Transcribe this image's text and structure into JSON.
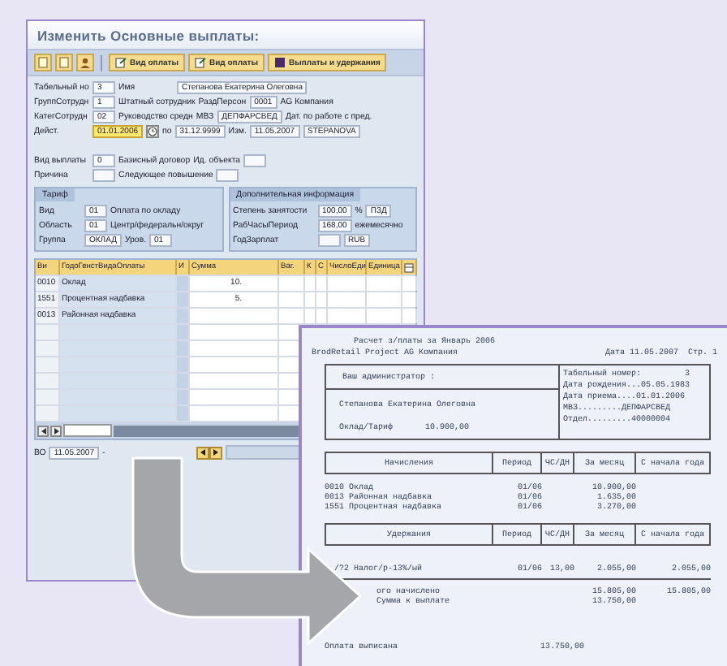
{
  "sap_window": {
    "title": "Изменить Основные выплаты:",
    "toolbar": [
      {
        "label": "Вид оплаты"
      },
      {
        "label": "Вид оплаты"
      },
      {
        "label": "Выплаты и удержания"
      }
    ],
    "header_rows": [
      [
        {
          "kind": "label",
          "text": "Табельный но"
        },
        {
          "kind": "field",
          "value": "3",
          "focused": false
        },
        {
          "kind": "label",
          "text": "Имя"
        },
        {
          "kind": "field",
          "value": "Степанова Екатерина Олеговна",
          "focused": false
        }
      ],
      [
        {
          "kind": "label",
          "text": "ГруппСотрудн"
        },
        {
          "kind": "field",
          "value": "1",
          "focused": false
        },
        {
          "kind": "text",
          "text": "Штатный сотрудник"
        },
        {
          "kind": "text",
          "text": "РаздПерсон"
        },
        {
          "kind": "field",
          "value": "0001",
          "focused": false
        },
        {
          "kind": "text",
          "text": "AG Компания"
        }
      ],
      [
        {
          "kind": "label",
          "text": "КатегСотрудн"
        },
        {
          "kind": "field",
          "value": "02",
          "focused": false
        },
        {
          "kind": "text",
          "text": "Руководство средн"
        },
        {
          "kind": "text",
          "text": "МВЗ"
        },
        {
          "kind": "field",
          "value": "ДЕПФАРСВЕД",
          "focused": false
        },
        {
          "kind": "text",
          "text": "Дат. по работе с пред."
        }
      ],
      [
        {
          "kind": "label",
          "text": "Дейст."
        },
        {
          "kind": "field",
          "value": "01.01.2006",
          "focused": true
        },
        {
          "kind": "calendar"
        },
        {
          "kind": "text",
          "text": "по"
        },
        {
          "kind": "field",
          "value": "31.12.9999",
          "focused": false
        },
        {
          "kind": "text",
          "text": "Изм."
        },
        {
          "kind": "field",
          "value": "11.05.2007",
          "focused": false
        },
        {
          "kind": "field",
          "value": "STEPANOVA",
          "focused": false
        }
      ]
    ],
    "reason_rows": [
      [
        {
          "kind": "label",
          "text": "Вид выплаты"
        },
        {
          "kind": "field",
          "value": "0",
          "focused": false
        },
        {
          "kind": "text",
          "text": "Базисный договор"
        },
        {
          "kind": "text",
          "text": "Ид. объекта"
        },
        {
          "kind": "field",
          "focused": false
        }
      ],
      [
        {
          "kind": "label",
          "text": "Причина"
        },
        {
          "kind": "field",
          "focused": false
        },
        {
          "kind": "text",
          "text": "Следующее повышение"
        },
        {
          "kind": "field",
          "focused": false
        }
      ]
    ],
    "groups": [
      {
        "title": "Тариф",
        "rows": [
          [
            {
              "kind": "label",
              "text": "Вид"
            },
            {
              "kind": "field",
              "value": "01",
              "focused": false
            },
            {
              "kind": "text",
              "text": "Оплата по окладу"
            }
          ],
          [
            {
              "kind": "label",
              "text": "Область"
            },
            {
              "kind": "field",
              "value": "01",
              "focused": false
            },
            {
              "kind": "text",
              "text": "Центр/федеральн/округ"
            }
          ],
          [
            {
              "kind": "label",
              "text": "Группа"
            },
            {
              "kind": "field",
              "value": "ОКЛАД",
              "focused": false
            },
            {
              "kind": "text",
              "text": "Уров."
            },
            {
              "kind": "field",
              "value": "01",
              "focused": false
            }
          ]
        ]
      },
      {
        "title": "Дополнительная информация",
        "rows": [
          [
            {
              "kind": "label",
              "text": "Степень занятости"
            },
            {
              "kind": "field",
              "value": "100,00",
              "focused": false
            },
            {
              "kind": "text",
              "text": "%"
            },
            {
              "kind": "field",
              "value": "ПЗД",
              "focused": false
            }
          ],
          [
            {
              "kind": "label",
              "text": "РабЧасыПериод"
            },
            {
              "kind": "field",
              "value": "168,00",
              "focused": false
            },
            {
              "kind": "text",
              "text": "ежемесячно"
            }
          ],
          [
            {
              "kind": "label",
              "text": "ГодЗарплат"
            },
            {
              "kind": "field",
              "focused": false
            },
            {
              "kind": "field",
              "value": "RUB",
              "focused": false
            }
          ]
        ]
      }
    ],
    "table": {
      "columns": [
        "Ви",
        "ГодоГенстВидаОплаты",
        "И",
        "Сумма",
        "Ваг.",
        "К",
        "С",
        "ЧислоЕди",
        "Единица"
      ],
      "rows": [
        {
          "code": "0010",
          "name": "Оклад",
          "amount": "10."
        },
        {
          "code": "1551",
          "name": "Процентная надбавка",
          "amount": "5."
        },
        {
          "code": "0013",
          "name": "Районная надбавка"
        }
      ]
    },
    "footer": {
      "label": "ВО",
      "date": "11.05.2007",
      "separator": "-"
    }
  },
  "payslip": {
    "title": "Расчет з/платы за Январь 2006",
    "company": "BrodRetail Project AG Компания",
    "date": "Дата 11.05.2007",
    "page": "Стр. 1",
    "administrator": "Ваш администратор :",
    "employee": "Степанова Екатерина Олеговна",
    "salary_label": "Оклад/Тариф",
    "salary": "10.900,00",
    "details": [
      "Табельный номер:         3",
      "Дата рождения...05.05.1983",
      "Дата приема....01.01.2006",
      "МВЗ.........ДЕПФАРСВЕД",
      "Отдел.........40000004"
    ],
    "earnings_header": [
      "Начисления",
      "Период",
      "ЧС/ДН",
      "За месяц",
      "С начала года"
    ],
    "earnings": [
      {
        "name": "0010 Оклад",
        "period": "01/06",
        "month": "10.900,00"
      },
      {
        "name": "0013 Районная надбавка",
        "period": "01/06",
        "month": "1.635,00"
      },
      {
        "name": "1551 Процентная надбавка",
        "period": "01/06",
        "month": "3.270,00"
      }
    ],
    "deductions_header": [
      "Удержания",
      "Период",
      "ЧС/ДН",
      "За месяц",
      "С начала года"
    ],
    "deductions": [
      {
        "name": "/?2 Налог/р-13%/ый",
        "period": "01/06",
        "hours": "13,00",
        "month": "2.055,00",
        "year": "2.055,00"
      }
    ],
    "totals": [
      {
        "label": "ого начислено",
        "month": "15.805,00",
        "year": "15.805,00"
      },
      {
        "label": "Сумма к выплате",
        "month": "13.750,00"
      }
    ],
    "payment": [
      "Оплата выписана",
      "13.750,00"
    ]
  }
}
